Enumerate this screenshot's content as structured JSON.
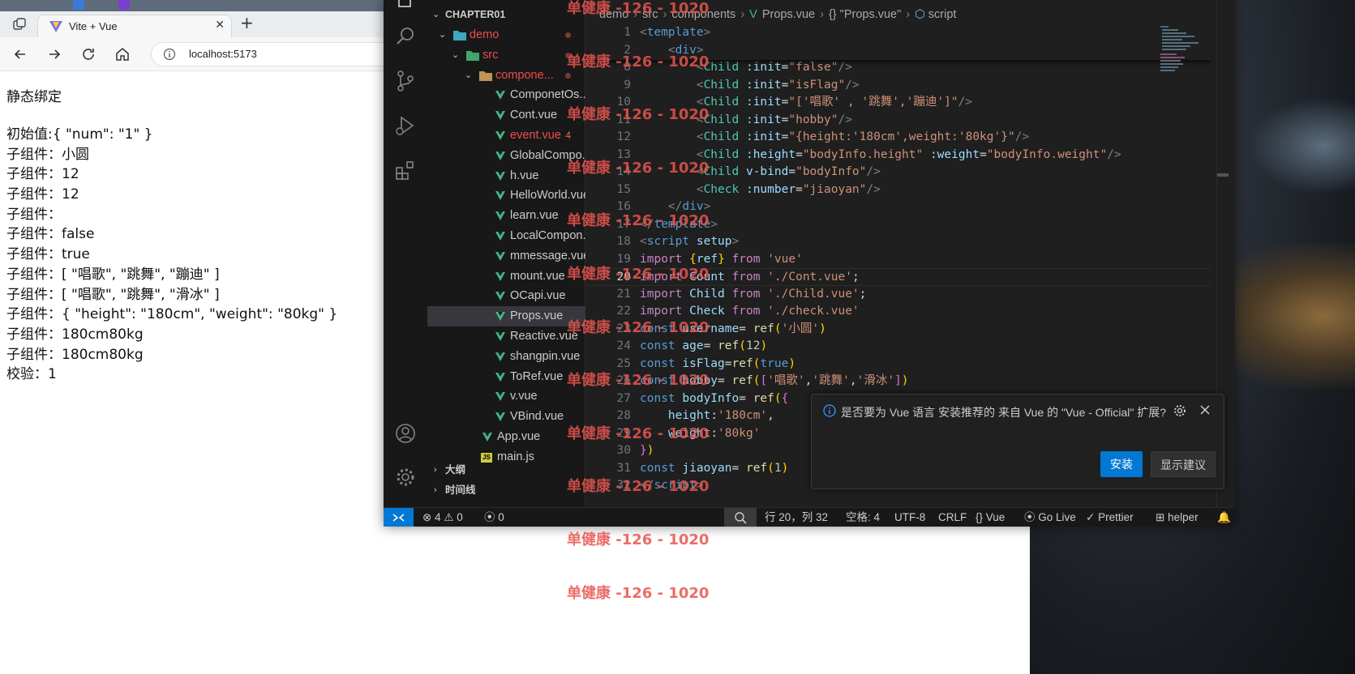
{
  "browser": {
    "tab_title": "Vite + Vue",
    "url": "localhost:5173"
  },
  "page": {
    "heading": "静态绑定",
    "lines": [
      "初始值:{ \"num\": \"1\" }",
      "子组件：小圆",
      "子组件：12",
      "子组件：12",
      "子组件：",
      "子组件：false",
      "子组件：true",
      "子组件：[ \"唱歌\", \"跳舞\", \"蹦迪\" ]",
      "子组件：[ \"唱歌\", \"跳舞\", \"滑冰\" ]",
      "子组件：{ \"height\": \"180cm\", \"weight\": \"80kg\" }",
      "子组件：180cm80kg",
      "子组件：180cm80kg",
      "校验：1"
    ]
  },
  "explorer": {
    "root": "CHAPTER01",
    "items": [
      {
        "label": "demo",
        "kind": "folder-open"
      },
      {
        "label": "src",
        "kind": "folder-open"
      },
      {
        "label": "compone...",
        "kind": "folder-open"
      },
      {
        "label": "ComponetOs...",
        "kind": "vue"
      },
      {
        "label": "Cont.vue",
        "kind": "vue"
      },
      {
        "label": "event.vue",
        "kind": "vue",
        "badge": "4"
      },
      {
        "label": "GlobalCompo...",
        "kind": "vue"
      },
      {
        "label": "h.vue",
        "kind": "vue"
      },
      {
        "label": "HelloWorld.vue",
        "kind": "vue"
      },
      {
        "label": "learn.vue",
        "kind": "vue"
      },
      {
        "label": "LocalCompon...",
        "kind": "vue"
      },
      {
        "label": "mmessage.vue",
        "kind": "vue"
      },
      {
        "label": "mount.vue",
        "kind": "vue"
      },
      {
        "label": "OCapi.vue",
        "kind": "vue"
      },
      {
        "label": "Props.vue",
        "kind": "vue",
        "selected": true
      },
      {
        "label": "Reactive.vue",
        "kind": "vue"
      },
      {
        "label": "shangpin.vue",
        "kind": "vue"
      },
      {
        "label": "ToRef.vue",
        "kind": "vue"
      },
      {
        "label": "v.vue",
        "kind": "vue"
      },
      {
        "label": "VBind.vue",
        "kind": "vue"
      },
      {
        "label": "App.vue",
        "kind": "vue"
      },
      {
        "label": "main.js",
        "kind": "js"
      }
    ],
    "outline_label": "大纲",
    "timeline_label": "时间线"
  },
  "breadcrumb": [
    "demo",
    "src",
    "components",
    "Props.vue",
    "{} \"Props.vue\"",
    "script"
  ],
  "code": {
    "current_line": "20",
    "lines": [
      {
        "n": "1",
        "parts": [
          [
            "tgb",
            "<"
          ],
          [
            "tg",
            "template"
          ],
          [
            "tgb",
            ">"
          ]
        ]
      },
      {
        "n": "2",
        "parts": [
          [
            "pl",
            "    "
          ],
          [
            "tgb",
            "<"
          ],
          [
            "tg",
            "div"
          ],
          [
            "tgb",
            ">"
          ]
        ]
      },
      {
        "n": "8",
        "parts": [
          [
            "pl",
            "        "
          ],
          [
            "tgb",
            "<"
          ],
          [
            "cy",
            "Child"
          ],
          [
            "pl",
            " "
          ],
          [
            "at",
            ":init"
          ],
          [
            "pl",
            "="
          ],
          [
            "st",
            "\"false\""
          ],
          [
            "tgb",
            "/>"
          ]
        ]
      },
      {
        "n": "9",
        "parts": [
          [
            "pl",
            "        "
          ],
          [
            "tgb",
            "<"
          ],
          [
            "cy",
            "Child"
          ],
          [
            "pl",
            " "
          ],
          [
            "at",
            ":init"
          ],
          [
            "pl",
            "="
          ],
          [
            "st",
            "\"isFlag\""
          ],
          [
            "tgb",
            "/>"
          ]
        ]
      },
      {
        "n": "10",
        "parts": [
          [
            "pl",
            "        "
          ],
          [
            "tgb",
            "<"
          ],
          [
            "cy",
            "Child"
          ],
          [
            "pl",
            " "
          ],
          [
            "at",
            ":init"
          ],
          [
            "pl",
            "="
          ],
          [
            "st",
            "\"['唱歌' , '跳舞','蹦迪']\""
          ],
          [
            "tgb",
            "/>"
          ]
        ]
      },
      {
        "n": "11",
        "parts": [
          [
            "pl",
            "        "
          ],
          [
            "tgb",
            "<"
          ],
          [
            "cy",
            "Child"
          ],
          [
            "pl",
            " "
          ],
          [
            "at",
            ":init"
          ],
          [
            "pl",
            "="
          ],
          [
            "st",
            "\"hobby\""
          ],
          [
            "tgb",
            "/>"
          ]
        ]
      },
      {
        "n": "12",
        "parts": [
          [
            "pl",
            "        "
          ],
          [
            "tgb",
            "<"
          ],
          [
            "cy",
            "Child"
          ],
          [
            "pl",
            " "
          ],
          [
            "at",
            ":init"
          ],
          [
            "pl",
            "="
          ],
          [
            "st",
            "\"{height:'180cm',weight:'80kg'}\""
          ],
          [
            "tgb",
            "/>"
          ]
        ]
      },
      {
        "n": "13",
        "parts": [
          [
            "pl",
            "        "
          ],
          [
            "tgb",
            "<"
          ],
          [
            "cy",
            "Child"
          ],
          [
            "pl",
            " "
          ],
          [
            "at",
            ":height"
          ],
          [
            "pl",
            "="
          ],
          [
            "st",
            "\"bodyInfo.height\""
          ],
          [
            "pl",
            " "
          ],
          [
            "at",
            ":weight"
          ],
          [
            "pl",
            "="
          ],
          [
            "st",
            "\"bodyInfo.weight\""
          ],
          [
            "tgb",
            "/>"
          ]
        ]
      },
      {
        "n": "14",
        "parts": [
          [
            "pl",
            "        "
          ],
          [
            "tgb",
            "<"
          ],
          [
            "cy",
            "Child"
          ],
          [
            "pl",
            " "
          ],
          [
            "at",
            "v-bind"
          ],
          [
            "pl",
            "="
          ],
          [
            "st",
            "\"bodyInfo\""
          ],
          [
            "tgb",
            "/>"
          ]
        ]
      },
      {
        "n": "15",
        "parts": [
          [
            "pl",
            "        "
          ],
          [
            "tgb",
            "<"
          ],
          [
            "cy",
            "Check"
          ],
          [
            "pl",
            " "
          ],
          [
            "at",
            ":number"
          ],
          [
            "pl",
            "="
          ],
          [
            "st",
            "\"jiaoyan\""
          ],
          [
            "tgb",
            "/>"
          ]
        ]
      },
      {
        "n": "16",
        "parts": [
          [
            "pl",
            "    "
          ],
          [
            "tgb",
            "</"
          ],
          [
            "tg",
            "div"
          ],
          [
            "tgb",
            ">"
          ]
        ]
      },
      {
        "n": "17",
        "parts": [
          [
            "tgb",
            "</"
          ],
          [
            "tg",
            "template"
          ],
          [
            "tgb",
            ">"
          ]
        ]
      },
      {
        "n": "18",
        "parts": [
          [
            "tgb",
            "<"
          ],
          [
            "tg",
            "script"
          ],
          [
            "pl",
            " "
          ],
          [
            "at",
            "setup"
          ],
          [
            "tgb",
            ">"
          ]
        ]
      },
      {
        "n": "19",
        "parts": [
          [
            "kw",
            "import"
          ],
          [
            "pl",
            " "
          ],
          [
            "yb",
            "{"
          ],
          [
            "id",
            "ref"
          ],
          [
            "yb",
            "}"
          ],
          [
            "pl",
            " "
          ],
          [
            "kw",
            "from"
          ],
          [
            "pl",
            " "
          ],
          [
            "st",
            "'vue'"
          ]
        ]
      },
      {
        "n": "20",
        "parts": [
          [
            "kw",
            "import"
          ],
          [
            "pl",
            " "
          ],
          [
            "id",
            "Count"
          ],
          [
            "pl",
            " "
          ],
          [
            "kw",
            "from"
          ],
          [
            "pl",
            " "
          ],
          [
            "st",
            "'./Cont.vue'"
          ],
          [
            "pl",
            ";"
          ]
        ]
      },
      {
        "n": "21",
        "parts": [
          [
            "kw",
            "import"
          ],
          [
            "pl",
            " "
          ],
          [
            "id",
            "Child"
          ],
          [
            "pl",
            " "
          ],
          [
            "kw",
            "from"
          ],
          [
            "pl",
            " "
          ],
          [
            "st",
            "'./Child.vue'"
          ],
          [
            "pl",
            ";"
          ]
        ]
      },
      {
        "n": "22",
        "parts": [
          [
            "kw",
            "import"
          ],
          [
            "pl",
            " "
          ],
          [
            "id",
            "Check"
          ],
          [
            "pl",
            " "
          ],
          [
            "kw",
            "from"
          ],
          [
            "pl",
            " "
          ],
          [
            "st",
            "'./check.vue'"
          ]
        ]
      },
      {
        "n": "23",
        "parts": [
          [
            "bl",
            "const"
          ],
          [
            "pl",
            " "
          ],
          [
            "id",
            "username"
          ],
          [
            "pl",
            "= "
          ],
          [
            "fn",
            "ref"
          ],
          [
            "yb",
            "("
          ],
          [
            "st",
            "'小圆'"
          ],
          [
            "yb",
            ")"
          ]
        ]
      },
      {
        "n": "24",
        "parts": [
          [
            "bl",
            "const"
          ],
          [
            "pl",
            " "
          ],
          [
            "id",
            "age"
          ],
          [
            "pl",
            "= "
          ],
          [
            "fn",
            "ref"
          ],
          [
            "yb",
            "("
          ],
          [
            "nm",
            "12"
          ],
          [
            "yb",
            ")"
          ]
        ]
      },
      {
        "n": "25",
        "parts": [
          [
            "bl",
            "const"
          ],
          [
            "pl",
            " "
          ],
          [
            "id",
            "isFlag"
          ],
          [
            "pl",
            "="
          ],
          [
            "fn",
            "ref"
          ],
          [
            "yb",
            "("
          ],
          [
            "bl",
            "true"
          ],
          [
            "yb",
            ")"
          ]
        ]
      },
      {
        "n": "26",
        "parts": [
          [
            "bl",
            "const"
          ],
          [
            "pl",
            " "
          ],
          [
            "id",
            "hobby"
          ],
          [
            "pl",
            "= "
          ],
          [
            "fn",
            "ref"
          ],
          [
            "yb",
            "("
          ],
          [
            "pb",
            "["
          ],
          [
            "st",
            "'唱歌'"
          ],
          [
            "pl",
            ","
          ],
          [
            "st",
            "'跳舞'"
          ],
          [
            "pl",
            ","
          ],
          [
            "st",
            "'滑冰'"
          ],
          [
            "pb",
            "]"
          ],
          [
            "yb",
            ")"
          ]
        ]
      },
      {
        "n": "27",
        "parts": [
          [
            "bl",
            "const"
          ],
          [
            "pl",
            " "
          ],
          [
            "id",
            "bodyInfo"
          ],
          [
            "pl",
            "= "
          ],
          [
            "fn",
            "ref"
          ],
          [
            "yb",
            "("
          ],
          [
            "pb",
            "{"
          ]
        ]
      },
      {
        "n": "28",
        "parts": [
          [
            "pl",
            "    "
          ],
          [
            "id",
            "height"
          ],
          [
            "pl",
            ":"
          ],
          [
            "st",
            "'180cm'"
          ],
          [
            "pl",
            ","
          ]
        ]
      },
      {
        "n": "29",
        "parts": [
          [
            "pl",
            "    "
          ],
          [
            "id",
            "weight"
          ],
          [
            "pl",
            ":"
          ],
          [
            "st",
            "'80kg'"
          ]
        ]
      },
      {
        "n": "30",
        "parts": [
          [
            "pb",
            "}"
          ],
          [
            "yb",
            ")"
          ]
        ]
      },
      {
        "n": "31",
        "parts": [
          [
            "bl",
            "const"
          ],
          [
            "pl",
            " "
          ],
          [
            "id",
            "jiaoyan"
          ],
          [
            "pl",
            "= "
          ],
          [
            "fn",
            "ref"
          ],
          [
            "yb",
            "("
          ],
          [
            "nm",
            "1"
          ],
          [
            "yb",
            ")"
          ]
        ]
      },
      {
        "n": "32",
        "parts": [
          [
            "tgb",
            "</"
          ],
          [
            "tg",
            "script"
          ],
          [
            "tgb",
            ">"
          ]
        ]
      }
    ]
  },
  "statusbar": {
    "errors": "4",
    "warnings": "0",
    "ports": "0",
    "position": "行 20，列 32",
    "spaces": "空格: 4",
    "encoding": "UTF-8",
    "eol": "CRLF",
    "language": "Vue",
    "golive": "Go Live",
    "prettier": "Prettier",
    "helper": "helper"
  },
  "notification": {
    "message": "是否要为 Vue 语言 安装推荐的 来自 Vue 的 \"Vue - Official\" 扩展?",
    "install_label": "安装",
    "show_label": "显示建议"
  },
  "watermark": "单健康 -126 - 1020",
  "colors": {
    "accent": "#0078d4",
    "editor_bg": "#1f1f1f",
    "sidebar_bg": "#181818"
  }
}
